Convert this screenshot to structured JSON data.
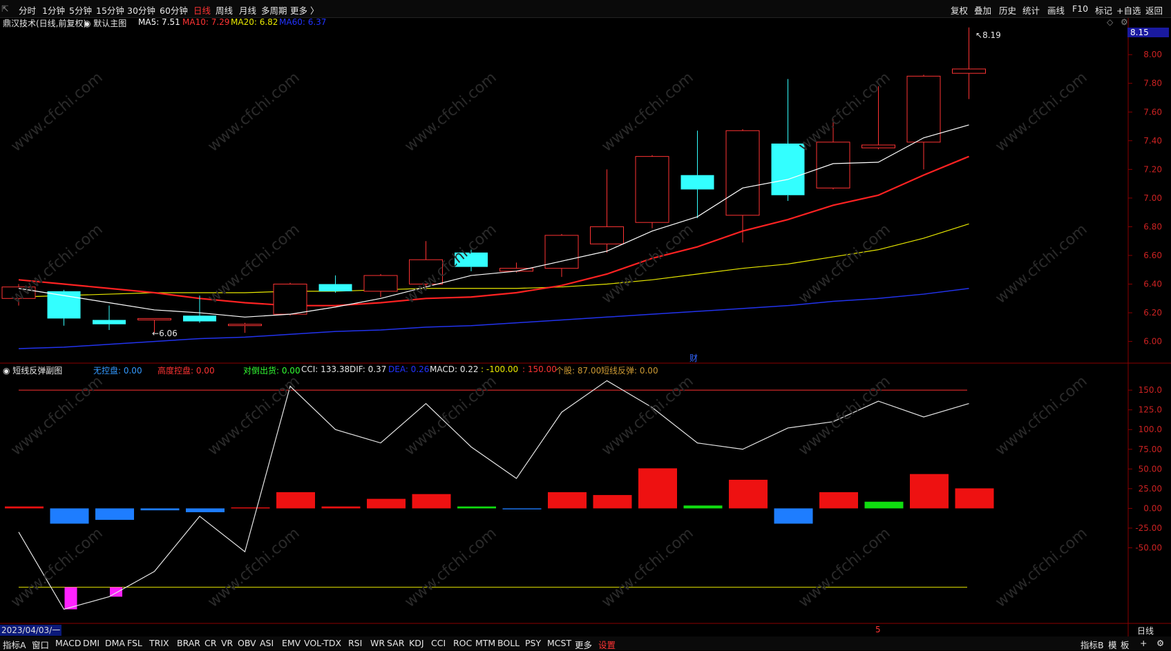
{
  "top_toolbar": {
    "left_items": [
      "分时",
      "1分钟",
      "5分钟",
      "15分钟",
      "30分钟",
      "60分钟",
      "日线",
      "周线",
      "月线",
      "多周期",
      "更多 〉"
    ],
    "active": "日线",
    "right_items": [
      "复权",
      "叠加",
      "历史",
      "统计",
      "画线",
      "F10",
      "标记",
      "+自选",
      "返回"
    ]
  },
  "main_chart_header": {
    "stock": "鼎汉技术(日线,前复权)",
    "template": "◉ 默认主图",
    "ma5": "MA5: 7.51",
    "ma10": "MA10: 7.29",
    "ma20": "MA20: 6.82",
    "ma60": "MA60: 6.37",
    "price_tag": "8.15"
  },
  "sub_chart_header": {
    "name": "短线反弹副图",
    "wukong": "无控盘: 0.00",
    "gaodu": "高度控盘: 0.00",
    "duidao": "对倒出货: 0.00",
    "cci": "CCI: 133.38",
    "dif": "DIF: 0.37",
    "dea": "DEA: 0.26",
    "macd": "MACD: 0.22",
    "neg100": ": -100.00",
    "pos150": ": 150.00",
    "gegu": "个股: 87.00",
    "duanxian": "短线反弹: 0.00"
  },
  "annotations": {
    "high": "8.19",
    "low": "6.06",
    "cai": "财",
    "date": "2023/04/03/一",
    "month_mark": "5",
    "period_label": "日线"
  },
  "price_axis": [
    "8.00",
    "7.80",
    "7.60",
    "7.40",
    "7.20",
    "7.00",
    "6.80",
    "6.60",
    "6.40",
    "6.20",
    "6.00"
  ],
  "sub_axis": [
    "150.0",
    "125.0",
    "100.0",
    "75.00",
    "50.00",
    "25.00",
    "0.00",
    "-25.00",
    "-50.00"
  ],
  "watermark": "www.cfchi.com",
  "bottom_tabs": [
    "指标A",
    "窗口",
    "MACD",
    "DMI",
    "DMA",
    "FSL",
    "TRIX",
    "BRAR",
    "CR",
    "VR",
    "OBV",
    "ASI",
    "EMV",
    "VOL-TDX",
    "RSI",
    "WR",
    "SAR",
    "KDJ",
    "CCI",
    "ROC",
    "MTM",
    "BOLL",
    "PSY",
    "MCST",
    "更多",
    "设置"
  ],
  "bottom_right": [
    "指标B",
    "模",
    "板",
    "+",
    "⚙"
  ],
  "chart_data": {
    "type": "candlestick",
    "candles": [
      {
        "o": 6.3,
        "c": 6.38,
        "h": 6.4,
        "l": 6.25
      },
      {
        "o": 6.35,
        "c": 6.16,
        "h": 6.36,
        "l": 6.11
      },
      {
        "o": 6.15,
        "c": 6.12,
        "h": 6.25,
        "l": 6.08
      },
      {
        "o": 6.15,
        "c": 6.16,
        "h": 6.16,
        "l": 6.06
      },
      {
        "o": 6.18,
        "c": 6.14,
        "h": 6.32,
        "l": 6.13
      },
      {
        "o": 6.12,
        "c": 6.12,
        "h": 6.13,
        "l": 6.06
      },
      {
        "o": 6.19,
        "c": 6.4,
        "h": 6.41,
        "l": 6.18
      },
      {
        "o": 6.4,
        "c": 6.35,
        "h": 6.46,
        "l": 6.34
      },
      {
        "o": 6.35,
        "c": 6.46,
        "h": 6.47,
        "l": 6.31
      },
      {
        "o": 6.4,
        "c": 6.57,
        "h": 6.7,
        "l": 6.38
      },
      {
        "o": 6.62,
        "c": 6.52,
        "h": 6.64,
        "l": 6.49
      },
      {
        "o": 6.49,
        "c": 6.51,
        "h": 6.55,
        "l": 6.48
      },
      {
        "o": 6.51,
        "c": 6.74,
        "h": 6.75,
        "l": 6.45
      },
      {
        "o": 6.68,
        "c": 6.8,
        "h": 7.2,
        "l": 6.62
      },
      {
        "o": 6.83,
        "c": 7.29,
        "h": 7.3,
        "l": 6.79
      },
      {
        "o": 7.16,
        "c": 7.06,
        "h": 7.47,
        "l": 6.86
      },
      {
        "o": 6.88,
        "c": 7.47,
        "h": 7.48,
        "l": 6.69
      },
      {
        "o": 7.38,
        "c": 7.02,
        "h": 7.83,
        "l": 6.98
      },
      {
        "o": 7.07,
        "c": 7.39,
        "h": 7.55,
        "l": 7.06
      },
      {
        "o": 7.35,
        "c": 7.37,
        "h": 7.78,
        "l": 7.34
      },
      {
        "o": 7.39,
        "c": 7.85,
        "h": 7.86,
        "l": 7.2
      },
      {
        "o": 7.87,
        "c": 7.9,
        "h": 8.19,
        "l": 7.69
      }
    ],
    "ma5": [
      6.37,
      6.32,
      6.27,
      6.22,
      6.2,
      6.17,
      6.19,
      6.24,
      6.3,
      6.38,
      6.46,
      6.49,
      6.56,
      6.63,
      6.77,
      6.87,
      7.07,
      7.13,
      7.24,
      7.25,
      7.42,
      7.51
    ],
    "ma10": [
      6.43,
      6.4,
      6.37,
      6.34,
      6.3,
      6.27,
      6.25,
      6.25,
      6.27,
      6.3,
      6.31,
      6.34,
      6.39,
      6.47,
      6.58,
      6.66,
      6.77,
      6.85,
      6.95,
      7.02,
      7.16,
      7.29
    ],
    "ma20": [
      6.31,
      6.32,
      6.33,
      6.34,
      6.34,
      6.34,
      6.35,
      6.35,
      6.36,
      6.37,
      6.37,
      6.37,
      6.38,
      6.4,
      6.43,
      6.47,
      6.51,
      6.54,
      6.59,
      6.64,
      6.72,
      6.82
    ],
    "ma60": [
      5.95,
      5.96,
      5.98,
      6.0,
      6.02,
      6.03,
      6.05,
      6.07,
      6.08,
      6.1,
      6.11,
      6.13,
      6.15,
      6.17,
      6.19,
      6.21,
      6.23,
      6.25,
      6.28,
      6.3,
      6.33,
      6.37
    ],
    "cci": [
      -30,
      -128,
      -112,
      -80,
      -10,
      -55,
      155,
      100,
      83,
      133,
      78,
      38,
      122,
      162,
      128,
      83,
      75,
      102,
      110,
      136,
      116,
      133
    ],
    "macd_bars": [
      2,
      -16,
      -12,
      -2,
      -4,
      1,
      17,
      2,
      10,
      15,
      2,
      -1,
      17,
      14,
      42,
      3,
      30,
      -16,
      17,
      7,
      36,
      21
    ],
    "pink_bars": [
      {
        "i": 1,
        "v": -128
      },
      {
        "i": 2,
        "v": -112
      }
    ]
  }
}
